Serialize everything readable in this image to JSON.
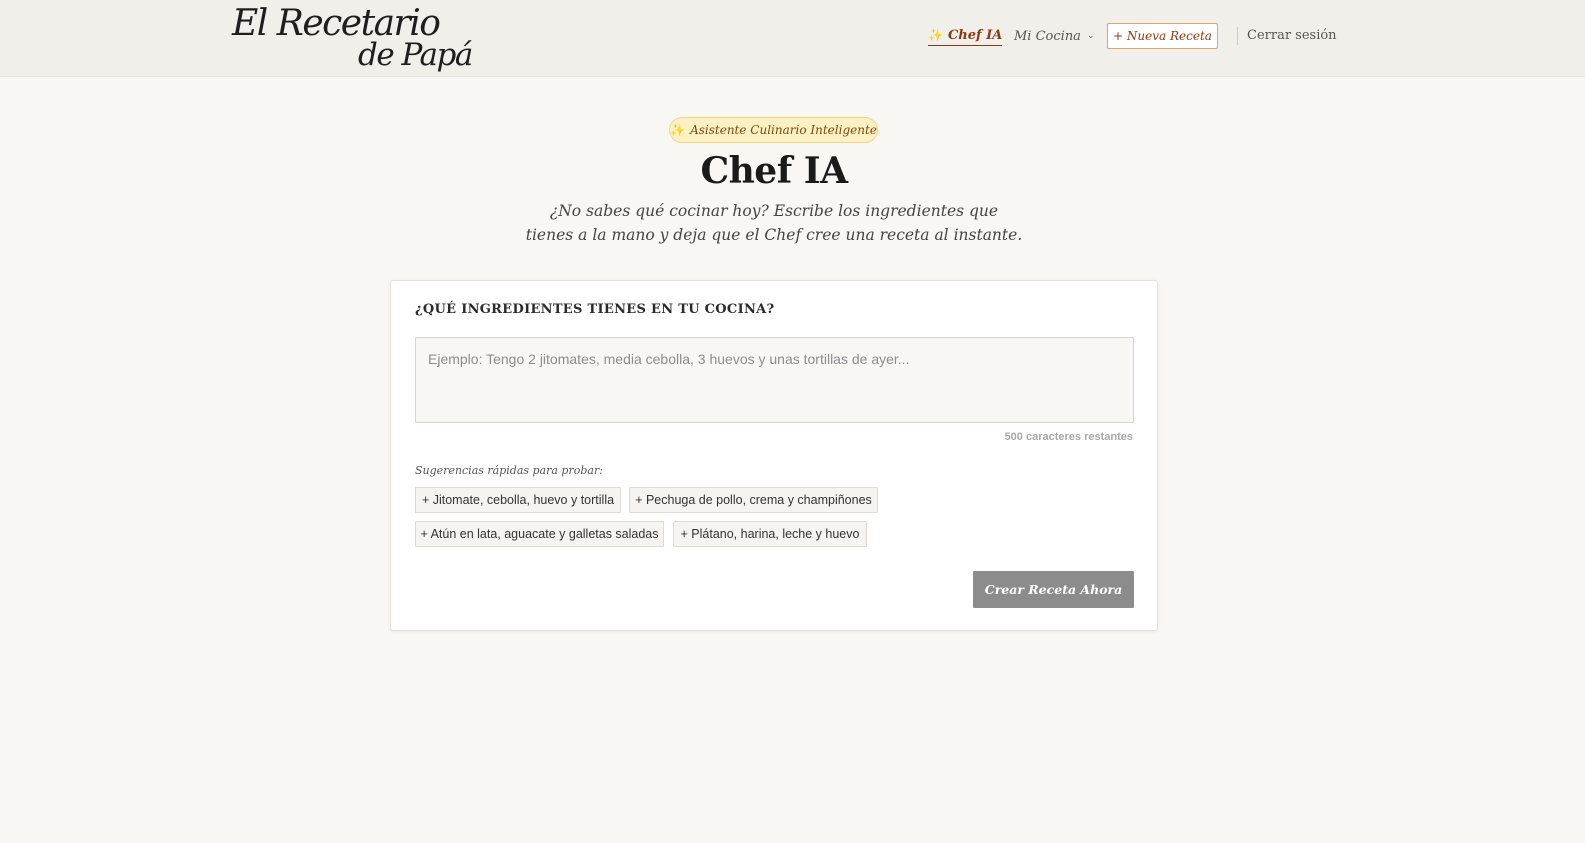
{
  "header": {
    "logo_line1": "El Recetario",
    "logo_line2": "de Papá",
    "nav": {
      "chef_label": "Chef IA",
      "chef_icon": "✨",
      "cocina_label": "Mi Cocina",
      "cocina_chevron": "⌄",
      "new_recipe_label": "+ Nueva Receta",
      "logout_label": "Cerrar sesión"
    }
  },
  "hero": {
    "badge_icon": "✨",
    "badge_label": "Asistente Culinario Inteligente",
    "title": "Chef IA",
    "subtitle": "¿No sabes qué cocinar hoy? Escribe los ingredientes que tienes a la mano y deja que el Chef cree una receta al instante."
  },
  "form": {
    "label": "¿QUÉ INGREDIENTES TIENES EN TU COCINA?",
    "placeholder": "Ejemplo: Tengo 2 jitomates, media cebolla, 3 huevos y unas tortillas de ayer...",
    "value": "",
    "char_count": "500 caracteres restantes",
    "suggestions_label": "Sugerencias rápidas para probar:",
    "suggestions": [
      "+ Jitomate, cebolla, huevo y tortilla",
      "+ Pechuga de pollo, crema y champiñones",
      "+ Atún en lata, aguacate y galletas saladas",
      "+ Plátano, harina, leche y huevo"
    ],
    "submit_label": "Crear Receta Ahora"
  },
  "colors": {
    "background": "#f9f7f3",
    "header": "#f1efea",
    "accent": "#8a3a12",
    "badge_bg": "#fdf1c3",
    "button_disabled": "#8c8c8c"
  }
}
